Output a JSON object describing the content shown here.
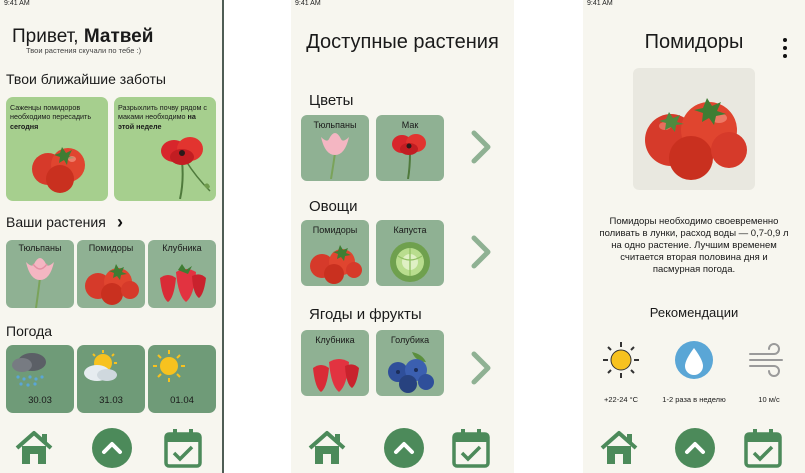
{
  "status_time": "9:41 AM",
  "home": {
    "greeting_prefix": "Привет,",
    "greeting_name": "Матвей",
    "greeting_sub": "Твои растения скучали по тебе :)",
    "cares_title": "Твои ближайшие заботы",
    "cares": [
      {
        "text": "Саженцы помидоров необходимо пересадить",
        "bold": "сегодня"
      },
      {
        "text": "Разрыхлить почву рядом с маками необходимо",
        "bold": "на этой неделе"
      }
    ],
    "plants_title": "Ваши растения",
    "plants": [
      "Тюльпаны",
      "Помидоры",
      "Клубника"
    ],
    "weather_title": "Погода",
    "weather": [
      {
        "date": "30.03",
        "icon": "rain-cloud-icon"
      },
      {
        "date": "31.03",
        "icon": "sun-cloud-icon"
      },
      {
        "date": "01.04",
        "icon": "sun-icon"
      }
    ]
  },
  "catalog": {
    "title": "Доступные растения",
    "categories": [
      {
        "name": "Цветы",
        "items": [
          "Тюльпаны",
          "Мак"
        ]
      },
      {
        "name": "Овощи",
        "items": [
          "Помидоры",
          "Капуста"
        ]
      },
      {
        "name": "Ягоды и фрукты",
        "items": [
          "Клубника",
          "Голубика"
        ]
      }
    ]
  },
  "detail": {
    "title": "Помидоры",
    "description": "Помидоры необходимо своевременно поливать в лунки, расход воды — 0,7-0,9 л на одно растение. Лучшим временем считается вторая половина дня и пасмурная погода.",
    "recs_title": "Рекомендации",
    "recs": [
      {
        "label": "+22-24 °С",
        "icon": "sun-icon"
      },
      {
        "label": "1-2 раза в неделю",
        "icon": "water-drop-icon"
      },
      {
        "label": "10 м/с",
        "icon": "wind-icon"
      }
    ]
  },
  "nav": {
    "home": "home-icon",
    "up": "chevron-up-icon",
    "calendar": "calendar-check-icon"
  },
  "colors": {
    "background": "#f7f6ef",
    "card_green": "#8fb193",
    "care_green": "#a6cf8e",
    "weather_green": "#6f9b78",
    "accent": "#4c8a5a"
  }
}
